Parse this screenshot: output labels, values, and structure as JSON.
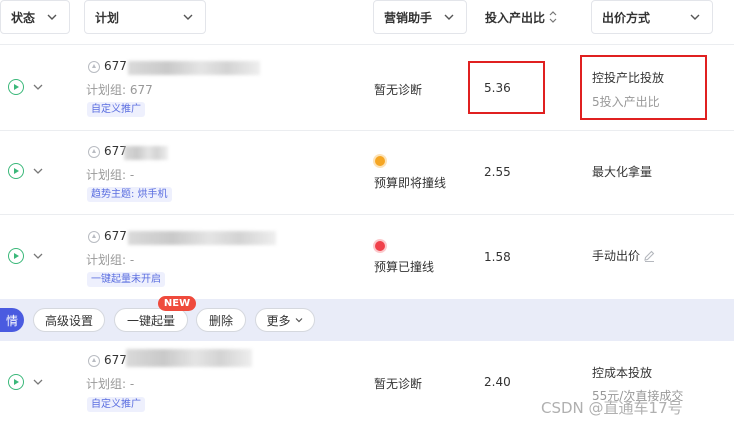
{
  "header": {
    "status_label": "状态",
    "plan_label": "计划",
    "marketing_label": "营销助手",
    "roi_label": "投入产出比",
    "bid_label": "出价方式"
  },
  "rows": [
    {
      "plan_id_prefix": "677",
      "group_text": "计划组: 677",
      "tag": "自定义推广",
      "marketing": "暂无诊断",
      "roi": "5.36",
      "bid": "控投产比投放",
      "bid_sub": "5投入产出比"
    },
    {
      "plan_id_prefix": "677",
      "group_text": "计划组: -",
      "tag": "趋势主题: 烘手机",
      "marketing": "预算即将撞线",
      "status_color": "#f5a623",
      "roi": "2.55",
      "bid": "最大化拿量"
    },
    {
      "plan_id_prefix": "677",
      "group_text": "计划组: -",
      "tag": "一键起量未开启",
      "marketing": "预算已撞线",
      "status_color": "#f0404a",
      "roi": "1.58",
      "bid": "手动出价"
    },
    {
      "plan_id_prefix": "677",
      "group_text": "计划组: -",
      "tag": "自定义推广",
      "marketing": "暂无诊断",
      "roi": "2.40",
      "bid": "控成本投放",
      "bid_sub": "55元/次直接成交"
    }
  ],
  "action_bar": {
    "primary": "情",
    "advanced": "高级设置",
    "boost": "一键起量",
    "boost_badge": "NEW",
    "delete": "删除",
    "more": "更多"
  },
  "watermark": "CSDN @直通车17号",
  "icons": {
    "play": "play-circle-icon",
    "chevron": "chevron-down-icon",
    "upload": "arrow-up-circle-icon",
    "sort": "sort-icon",
    "edit": "pencil-icon"
  },
  "colors": {
    "accent": "#4a5be0",
    "play_green": "#3bb87a",
    "highlight_red": "#e02020",
    "badge_red": "#ef4a3c"
  }
}
